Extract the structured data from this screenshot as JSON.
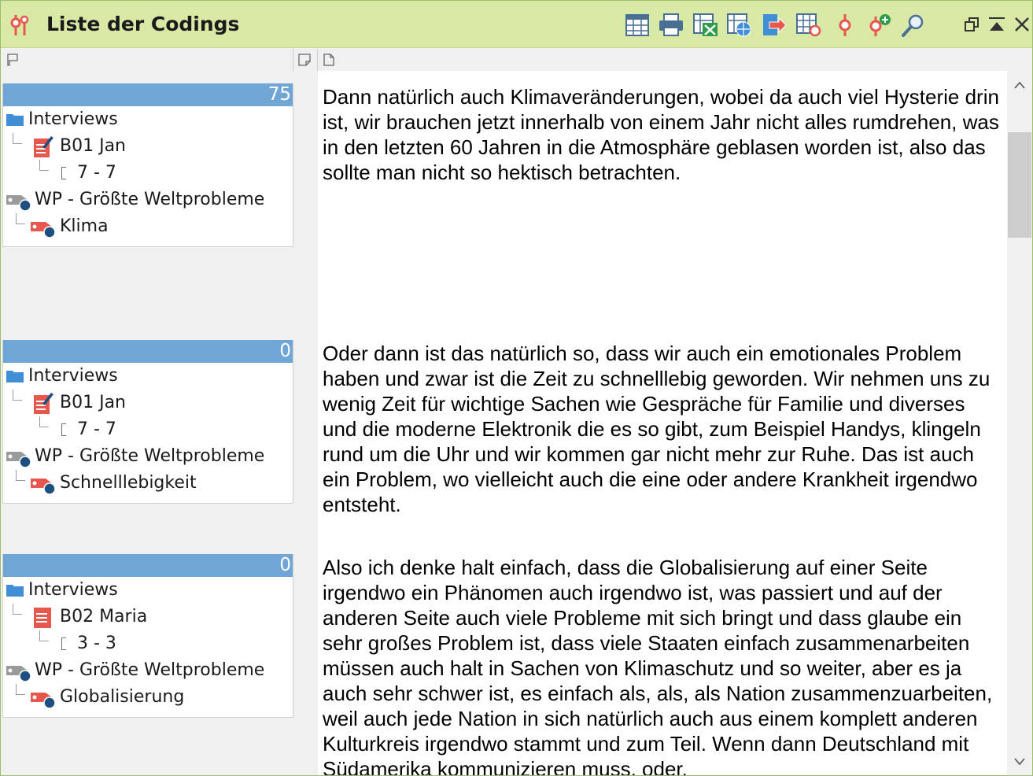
{
  "window": {
    "title": "Liste der Codings"
  },
  "toolbar": {
    "icons": [
      "table-view-icon",
      "print-icon",
      "excel-export-icon",
      "web-export-icon",
      "export-icon",
      "table-sync-icon",
      "coding-icon",
      "add-coding-icon",
      "search-icon"
    ]
  },
  "window_controls": [
    "restore-icon",
    "minimize-icon",
    "close-icon"
  ],
  "colors": {
    "titlebar": "#d8e9a6",
    "card_header": "#6fa6d6",
    "folder": "#3f8ed6",
    "document": "#e8574d",
    "code_tag": "#e8574d",
    "code_dot": "#1d4f80"
  },
  "codings": [
    {
      "count": "75",
      "group": "Interviews",
      "document": "B01 Jan",
      "range": "7 - 7",
      "parent_code": "WP - Größte Weltprobleme",
      "code": "Klima",
      "doc_edited": true,
      "text": "Dann natürlich auch Klimaveränderungen, wobei da auch viel Hysterie drin ist, wir brauchen jetzt innerhalb von einem Jahr nicht alles rumdrehen, was in den letzten 60 Jahren in die Atmosphäre geblasen worden ist, also das sollte man nicht so hektisch betrachten."
    },
    {
      "count": "0",
      "group": "Interviews",
      "document": "B01 Jan",
      "range": "7 - 7",
      "parent_code": "WP - Größte Weltprobleme",
      "code": "Schnelllebigkeit",
      "doc_edited": true,
      "text": "Oder dann ist das natürlich so, dass wir auch ein emotionales Problem haben und zwar ist die Zeit zu schnelllebig geworden. Wir nehmen uns zu wenig Zeit für wichtige Sachen wie Gespräche für Familie und diverses und die moderne Elektronik die es so gibt, zum Beispiel Handys, klingeln rund um die Uhr und wir kommen gar nicht mehr zur Ruhe. Das ist auch ein Problem, wo vielleicht auch die eine oder andere Krankheit irgendwo entsteht."
    },
    {
      "count": "0",
      "group": "Interviews",
      "document": "B02 Maria",
      "range": "3 - 3",
      "parent_code": "WP - Größte Weltprobleme",
      "code": "Globalisierung",
      "doc_edited": false,
      "text": "Also ich denke halt einfach, dass die Globalisierung auf einer Seite irgendwo ein Phänomen auch irgendwo ist, was passiert und auf der anderen Seite auch viele Probleme mit sich bringt und dass glaube ein sehr großes Problem ist, dass viele Staaten einfach zusammenarbeiten müssen auch halt in Sachen von Klimaschutz und so weiter, aber es ja auch sehr schwer ist, es einfach als, als, als Nation zusammenzuarbeiten, weil auch jede Nation in sich natürlich auch aus einem komplett anderen Kulturkreis irgendwo stammt und zum Teil. Wenn dann Deutschland mit Südamerika kommunizieren muss, oder."
    }
  ]
}
